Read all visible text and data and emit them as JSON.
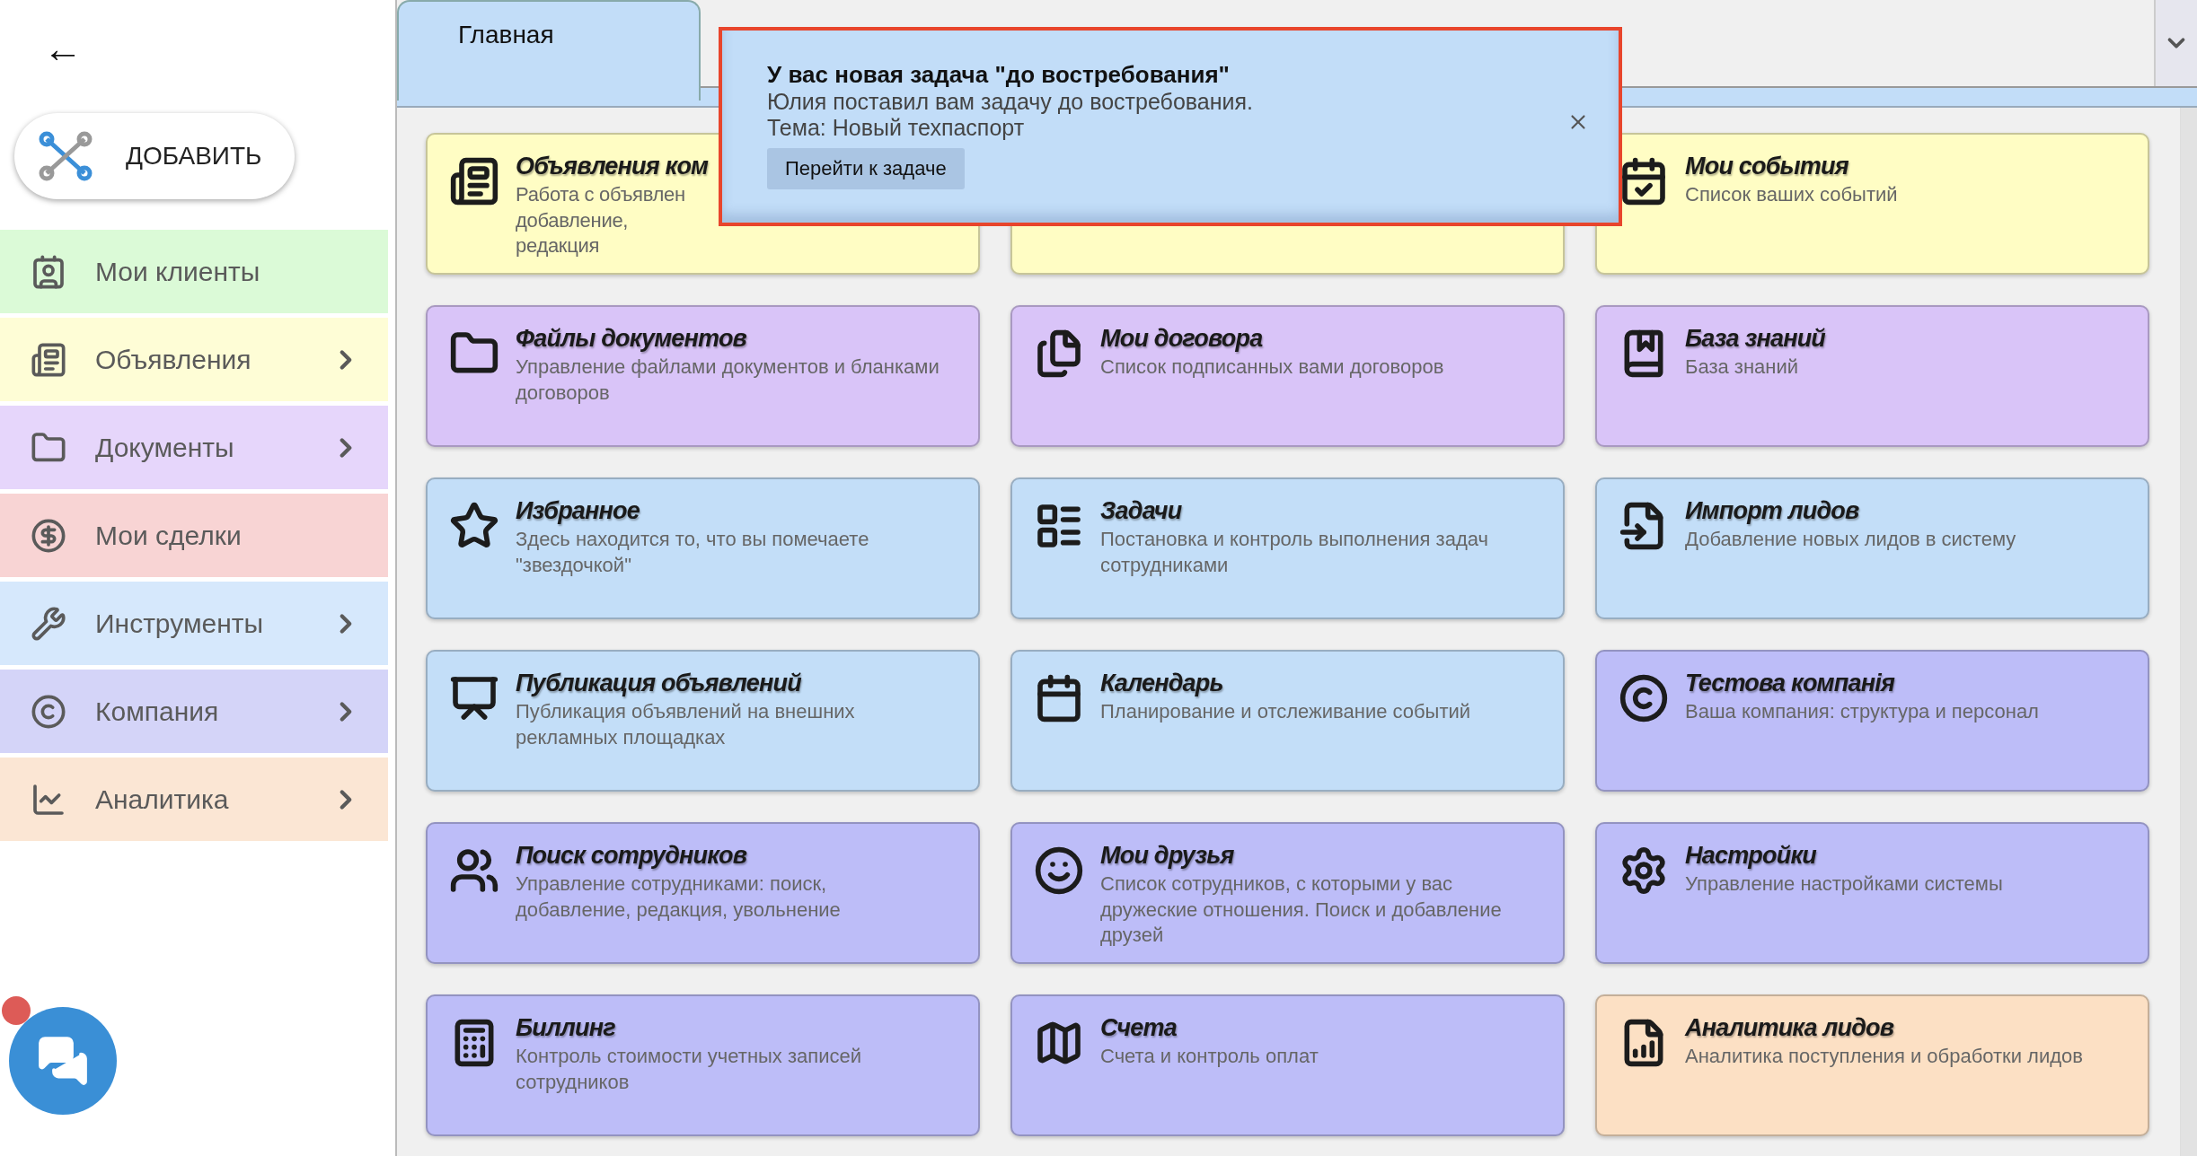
{
  "back_button": {
    "label": "←"
  },
  "add_button": {
    "label": "ДОБАВИТЬ"
  },
  "sidebar": {
    "items": [
      {
        "label": "Мои клиенты",
        "expandable": false,
        "color": "#dbfad7"
      },
      {
        "label": "Объявления",
        "expandable": true,
        "color": "#fefdd6"
      },
      {
        "label": "Документы",
        "expandable": true,
        "color": "#e6d6fb"
      },
      {
        "label": "Мои сделки",
        "expandable": false,
        "color": "#f8d4d4"
      },
      {
        "label": "Инструменты",
        "expandable": true,
        "color": "#d6e8fc"
      },
      {
        "label": "Компания",
        "expandable": true,
        "color": "#d4d4f8"
      },
      {
        "label": "Аналитика",
        "expandable": true,
        "color": "#fbe6d4"
      }
    ]
  },
  "tabs": [
    {
      "label": "Главная",
      "selected": true
    }
  ],
  "tiles": [
    {
      "title": "Объявления ком",
      "description": "Работа с объявлен добавление, редакция",
      "color": "#fffdc4"
    },
    {
      "color": "#fffdc4"
    },
    {
      "title": "Мои события",
      "description": "Список ваших событий",
      "color": "#fffdc4"
    },
    {
      "title": "Файлы документов",
      "description": "Управление файлами документов и бланками договоров",
      "color": "#d9c4f8"
    },
    {
      "title": "Мои договора",
      "description": "Список подписанных вами договоров",
      "color": "#d9c4f8"
    },
    {
      "title": "База знаний",
      "description": "База знаний",
      "color": "#d9c4f8"
    },
    {
      "title": "Избранное",
      "description": "Здесь находится то, что вы помечаете \"звездочкой\"",
      "color": "#c3def8"
    },
    {
      "title": "Задачи",
      "description": "Постановка и контроль выполнения задач сотрудниками",
      "color": "#c3def8"
    },
    {
      "title": "Импорт лидов",
      "description": "Добавление новых лидов в систему",
      "color": "#c3def8"
    },
    {
      "title": "Публикация объявлений",
      "description": "Публикация объявлений на внешних рекламных площадках",
      "color": "#c3def8"
    },
    {
      "title": "Календарь",
      "description": "Планирование и отслеживание событий",
      "color": "#c3def8"
    },
    {
      "title": "Тестова компанія",
      "description": "Ваша компания: структура и персонал",
      "color": "#bdbdf8"
    },
    {
      "title": "Поиск сотрудников",
      "description": "Управление сотрудниками: поиск, добавление, редакция, увольнение",
      "color": "#bdbdf8"
    },
    {
      "title": "Мои друзья",
      "description": "Список сотрудников, с которыми у вас дружеские отношения. Поиск и добавление друзей",
      "color": "#bdbdf8"
    },
    {
      "title": "Настройки",
      "description": "Управление настройками системы",
      "color": "#bdbdf8"
    },
    {
      "title": "Биллинг",
      "description": "Контроль стоимости учетных записей сотрудников",
      "color": "#bdbdf8"
    },
    {
      "title": "Счета",
      "description": "Счета и контроль оплат",
      "color": "#bdbdf8"
    },
    {
      "title": "Аналитика лидов",
      "description": "Аналитика поступления и обработки лидов",
      "color": "#fce0c4"
    }
  ],
  "notification": {
    "title": "У вас новая задача \"до востребования\"",
    "lines": [
      "Юлия поставил вам задачу до востребования.",
      "Тема: Новый техпаспорт"
    ],
    "action": "Перейти к задаче"
  },
  "chat": {
    "unread": true
  }
}
